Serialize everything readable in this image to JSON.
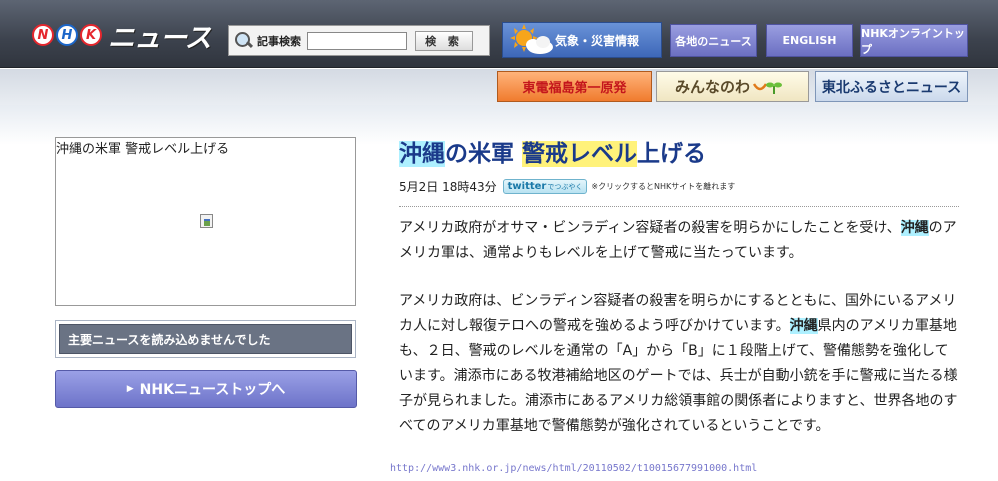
{
  "header": {
    "logo_letters": [
      "N",
      "H",
      "K"
    ],
    "logo_text": "ニュース",
    "search": {
      "label": "記事検索",
      "placeholder": "",
      "button_label": "検 索"
    },
    "weather_label": "気象・災害情報",
    "nav": [
      {
        "label": "各地のニュース"
      },
      {
        "label": "ENGLISH"
      },
      {
        "label": "NHKオンライントップ"
      }
    ]
  },
  "banners": {
    "fukushima": "東電福島第一原発",
    "minna_pre": "みんなのわ",
    "tohoku": "東北ふるさとニュース"
  },
  "left": {
    "image_alt_title": "沖縄の米軍 警戒レベル上げる",
    "main_news_error": "主要ニュースを読み込めませんでした",
    "top_link": "NHKニューストップへ"
  },
  "article": {
    "headline_parts": [
      "沖縄",
      "の米軍 ",
      "警戒レベル",
      "上げる"
    ],
    "date": "5月2日 18時43分",
    "twitter_main": "twitter",
    "twitter_sub": "でつぶやく",
    "twitter_note": "※クリックするとNHKサイトを離れます",
    "lead_pre": "アメリカ政府がオサマ・ビンラディン容疑者の殺害を明らかにしたことを受け、",
    "lead_kw": "沖縄",
    "lead_post": "のアメリカ軍は、通常よりもレベルを上げて警戒に当たっています。",
    "body_pre": "アメリカ政府は、ビンラディン容疑者の殺害を明らかにするとともに、国外にいるアメリカ人に対し報復テロへの警戒を強めるよう呼びかけています。",
    "body_kw": "沖縄",
    "body_post": "県内のアメリカ軍基地も、２日、警戒のレベルを通常の「A」から「B」に１段階上げて、警備態勢を強化しています。浦添市にある牧港補給地区のゲートでは、兵士が自動小銃を手に警戒に当たる様子が見られました。浦添市にあるアメリカ総領事館の関係者によりますと、世界各地のすべてのアメリカ軍基地で警備態勢が強化されているということです。"
  },
  "footer_url": "http://www3.nhk.or.jp/news/html/20110502/t10015677991000.html",
  "colors": {
    "header_bg": "#3c424d",
    "headline": "#1a3a8a",
    "highlight_cyan": "#aef0ff",
    "highlight_yellow": "#fff27a",
    "nav_purple": "#6b6fc2"
  }
}
